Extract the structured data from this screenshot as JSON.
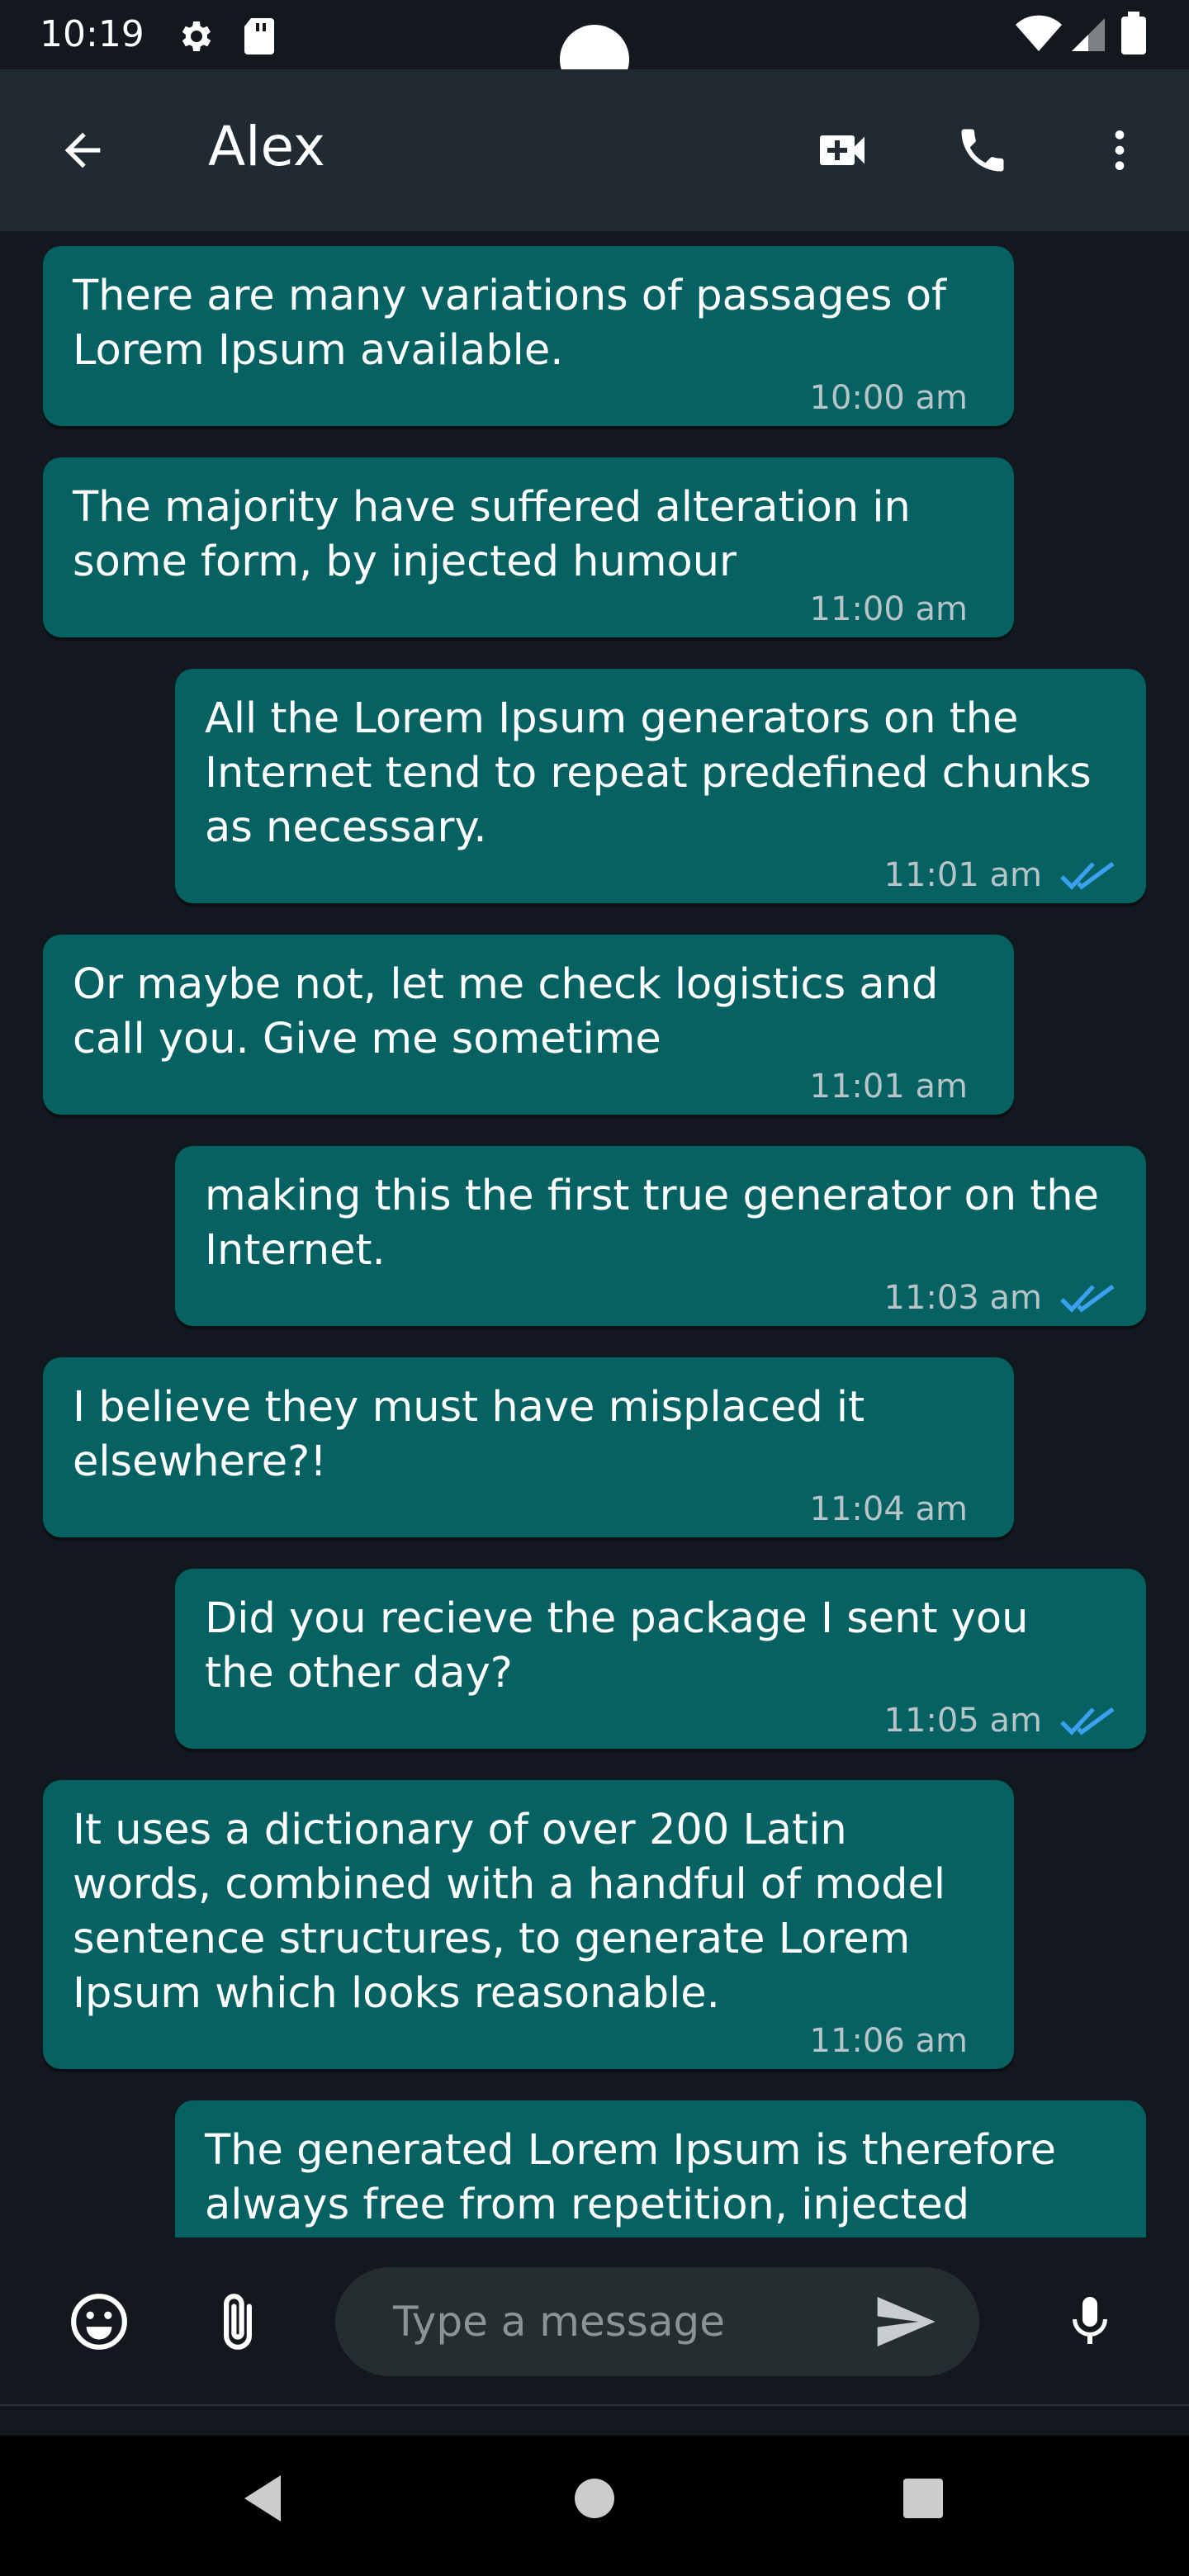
{
  "status_bar": {
    "time": "10:19",
    "icons": [
      "settings-icon",
      "sd-card-icon",
      "wifi-icon",
      "signal-icon",
      "battery-icon"
    ]
  },
  "app_bar": {
    "title": "Alex",
    "icons": [
      "back-arrow-icon",
      "video-call-icon",
      "phone-icon",
      "more-vert-icon"
    ]
  },
  "colors": {
    "bubble": "#056162",
    "background": "#12181e",
    "app_bar": "#1f2a32",
    "read_tick": "#3aa0f0"
  },
  "messages": [
    {
      "direction": "in",
      "text": "There are many variations of passages of\nLorem Ipsum available.",
      "time": "10:00 am"
    },
    {
      "direction": "in",
      "text": "The majority have suffered alteration in\nsome form, by injected humour",
      "time": "11:00 am"
    },
    {
      "direction": "out",
      "text": "All the Lorem Ipsum generators on the\nInternet tend to repeat predefined chunks\nas necessary.",
      "time": "11:01 am",
      "status": "read"
    },
    {
      "direction": "in",
      "text": "Or maybe not, let me check logistics and\ncall you. Give me sometime",
      "time": "11:01 am"
    },
    {
      "direction": "out",
      "text": "making this the first true generator on the\nInternet.",
      "time": "11:03 am",
      "status": "read"
    },
    {
      "direction": "in",
      "text": "I believe they must have misplaced it\nelsewhere?!",
      "time": "11:04 am"
    },
    {
      "direction": "out",
      "text": "Did you recieve the package I sent you\nthe other day?",
      "time": "11:05 am",
      "status": "read"
    },
    {
      "direction": "in",
      "text": "It uses a dictionary of over 200 Latin\nwords, combined with a handful of model\nsentence structures, to generate Lorem\nIpsum which looks reasonable.",
      "time": "11:06 am"
    },
    {
      "direction": "out",
      "text": "The generated Lorem Ipsum is therefore\nalways free from repetition, injected",
      "time": "",
      "status": "partial"
    }
  ],
  "input": {
    "placeholder": "Type a message",
    "icons": [
      "emoji-icon",
      "attach-icon",
      "send-icon",
      "mic-icon"
    ]
  },
  "nav_bar": {
    "icons": [
      "nav-back-icon",
      "nav-home-icon",
      "nav-recents-icon"
    ]
  }
}
